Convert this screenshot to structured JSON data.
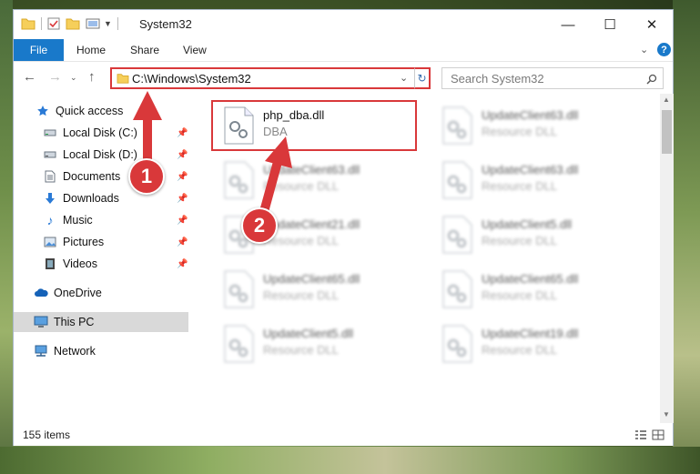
{
  "window": {
    "title": "System32"
  },
  "ribbon": {
    "file": "File",
    "home": "Home",
    "share": "Share",
    "view": "View"
  },
  "address": {
    "path": "C:\\Windows\\System32"
  },
  "search": {
    "placeholder": "Search System32"
  },
  "nav": {
    "quick_access": "Quick access",
    "local_c": "Local Disk (C:)",
    "local_d": "Local Disk (D:)",
    "documents": "Documents",
    "downloads": "Downloads",
    "music": "Music",
    "pictures": "Pictures",
    "videos": "Videos",
    "onedrive": "OneDrive",
    "thispc": "This PC",
    "network": "Network"
  },
  "files": [
    {
      "name": "php_dba.dll",
      "type": "DBA"
    },
    {
      "name": "UpdateClient63.dll",
      "type": "Resource DLL"
    },
    {
      "name": "UpdateClient63.dll",
      "type": "Resource DLL"
    },
    {
      "name": "UpdateClient63.dll",
      "type": "Resource DLL"
    },
    {
      "name": "UpdateClient21.dll",
      "type": "Resource DLL"
    },
    {
      "name": "UpdateClient5.dll",
      "type": "Resource DLL"
    },
    {
      "name": "UpdateClient65.dll",
      "type": "Resource DLL"
    },
    {
      "name": "UpdateClient65.dll",
      "type": "Resource DLL"
    },
    {
      "name": "UpdateClient5.dll",
      "type": "Resource DLL"
    },
    {
      "name": "UpdateClient19.dll",
      "type": "Resource DLL"
    }
  ],
  "status": {
    "count": "155 items"
  },
  "callouts": {
    "one": "1",
    "two": "2"
  },
  "colors": {
    "accent": "#1979ca",
    "highlight": "#d9383a"
  }
}
